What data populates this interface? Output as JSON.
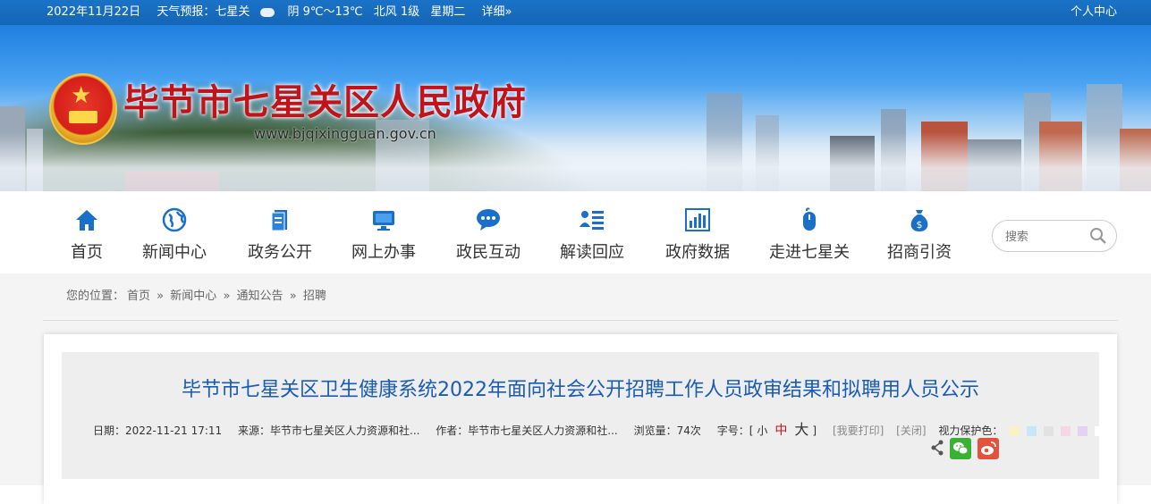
{
  "topbar": {
    "date": "2022年11月22日",
    "weather_label": "天气预报：七星关",
    "weather": "阴 9℃～13℃",
    "wind": "北风 1级",
    "weekday": "星期二",
    "detail": "详细»",
    "user_center": "个人中心"
  },
  "banner": {
    "title": "毕节市七星关区人民政府",
    "url": "www.bjqixingguan.gov.cn"
  },
  "nav": {
    "items": [
      {
        "label": "首页",
        "icon": "home-icon"
      },
      {
        "label": "新闻中心",
        "icon": "globe-icon"
      },
      {
        "label": "政务公开",
        "icon": "document-icon"
      },
      {
        "label": "网上办事",
        "icon": "monitor-icon"
      },
      {
        "label": "政民互动",
        "icon": "chat-icon"
      },
      {
        "label": "解读回应",
        "icon": "person-list-icon"
      },
      {
        "label": "政府数据",
        "icon": "bar-chart-icon"
      },
      {
        "label": "走进七星关",
        "icon": "mouse-icon"
      },
      {
        "label": "招商引资",
        "icon": "money-bag-icon"
      }
    ],
    "search_placeholder": "搜索"
  },
  "breadcrumb": {
    "prefix": "您的位置：",
    "items": [
      "首页",
      "新闻中心",
      "通知公告",
      "招聘"
    ],
    "sep": "»"
  },
  "article": {
    "title": "毕节市七星关区卫生健康系统2022年面向社会公开招聘工作人员政审结果和拟聘用人员公示",
    "date_label": "日期：",
    "date": "2022-11-21 17:11",
    "source_label": "来源：",
    "source": "毕节市七星关区人力资源和社...",
    "author_label": "作者：",
    "author": "毕节市七星关区人力资源和社...",
    "views_label": "浏览量：",
    "views": "74次",
    "font_label": "字号：[",
    "font_small": "小",
    "font_mid": "中",
    "font_large": "大",
    "font_close": "]",
    "print": "[我要打印]",
    "close": "[关闭]",
    "eye_label": "视力保护色：",
    "swatches": [
      "#f9f3c4",
      "#c8e6f7",
      "#e2e2e2",
      "#f6d5e5",
      "#e4d2f3",
      "#ffffff"
    ]
  }
}
